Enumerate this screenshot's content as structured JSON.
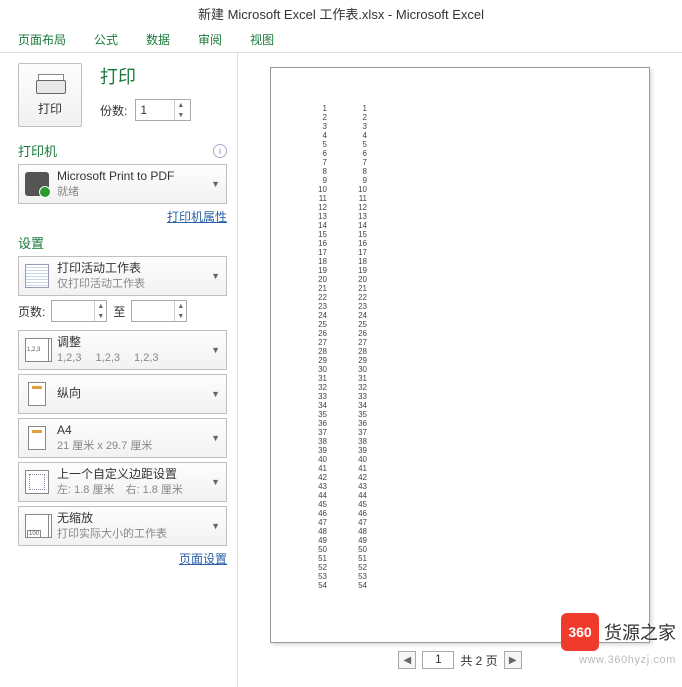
{
  "title": "新建 Microsoft Excel 工作表.xlsx - Microsoft Excel",
  "tabs": [
    "页面布局",
    "公式",
    "数据",
    "审阅",
    "视图"
  ],
  "print": {
    "button_label": "打印",
    "title": "打印",
    "copies_label": "份数:",
    "copies_value": "1"
  },
  "printer": {
    "section_label": "打印机",
    "name": "Microsoft Print to PDF",
    "status": "就绪",
    "properties_link": "打印机属性"
  },
  "settings": {
    "section_label": "设置",
    "active_sheets": {
      "line1": "打印活动工作表",
      "line2": "仅打印活动工作表"
    },
    "pages_label": "页数:",
    "to_label": "至",
    "collate": {
      "line1": "调整",
      "line2": "1,2,3  1,2,3  1,2,3"
    },
    "orientation": {
      "line1": "纵向"
    },
    "paper": {
      "line1": "A4",
      "line2": "21 厘米 x 29.7 厘米"
    },
    "margins": {
      "line1": "上一个自定义边距设置",
      "line2": "左: 1.8 厘米 右: 1.8 厘米"
    },
    "scaling": {
      "line1": "无缩放",
      "line2": "打印实际大小的工作表"
    },
    "page_setup_link": "页面设置"
  },
  "footer": {
    "current_page": "1",
    "total_text": "共 2 页"
  },
  "preview_data": {
    "columns": 2,
    "rows": 54
  },
  "watermark": {
    "badge": "360",
    "text": "货源之家",
    "url": "www.360hyzj.com"
  }
}
